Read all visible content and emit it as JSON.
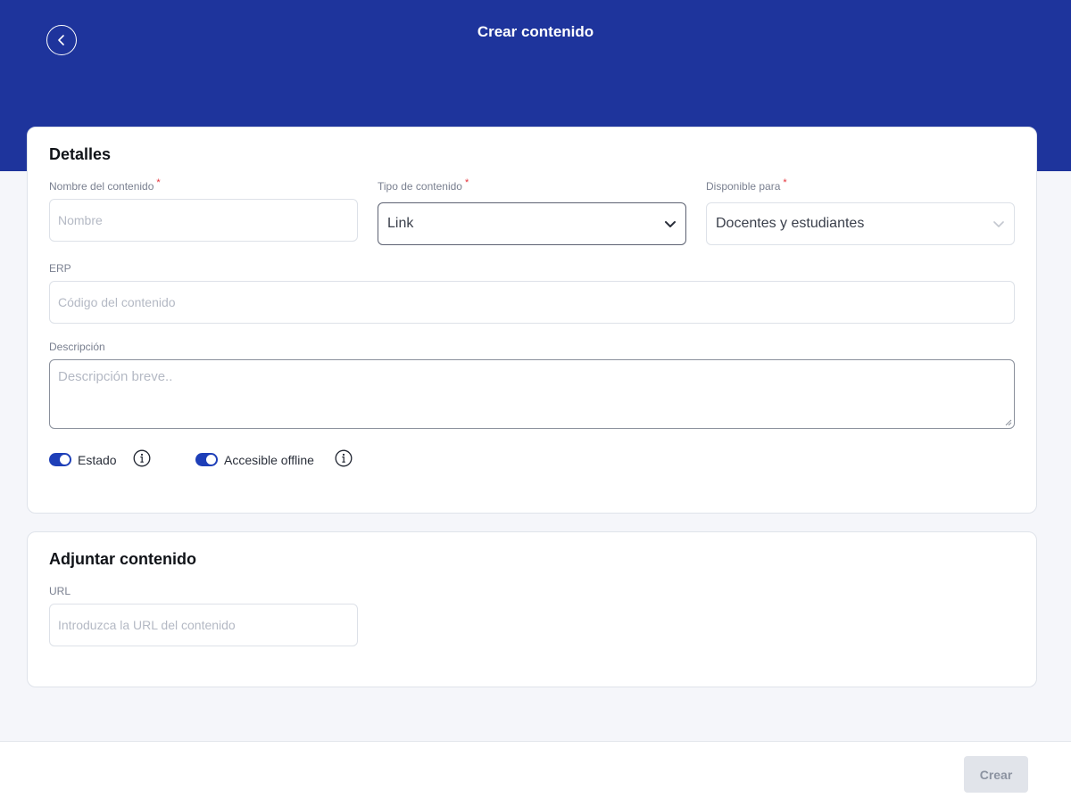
{
  "header": {
    "title": "Crear contenido",
    "back_icon": "chevron-left-icon",
    "background_color": "#1e349c"
  },
  "details": {
    "title": "Detalles",
    "name_field": {
      "label": "Nombre del contenido",
      "required_mark": "*",
      "placeholder": "Nombre",
      "value": ""
    },
    "type_field": {
      "label": "Tipo de contenido",
      "required_mark": "*",
      "selected": "Link"
    },
    "available_field": {
      "label": "Disponible para",
      "required_mark": "*",
      "selected": "Docentes y estudiantes"
    },
    "erp_field": {
      "label": "ERP",
      "placeholder": "Código del contenido",
      "value": ""
    },
    "description_field": {
      "label": "Descripción",
      "placeholder": "Descripción breve..",
      "value": ""
    },
    "toggles": [
      {
        "label": "Estado",
        "on": true,
        "info_icon": "info-icon"
      },
      {
        "label": "Accesible offline",
        "on": true,
        "info_icon": "info-icon"
      }
    ]
  },
  "attach": {
    "title": "Adjuntar contenido",
    "url_field": {
      "label": "URL",
      "placeholder": "Introduzca la URL del contenido",
      "value": ""
    }
  },
  "footer": {
    "create_label": "Crear"
  },
  "colors": {
    "accent": "#1e3fb8",
    "required": "#e5333a",
    "disabled_button": "#e1e4ea"
  }
}
